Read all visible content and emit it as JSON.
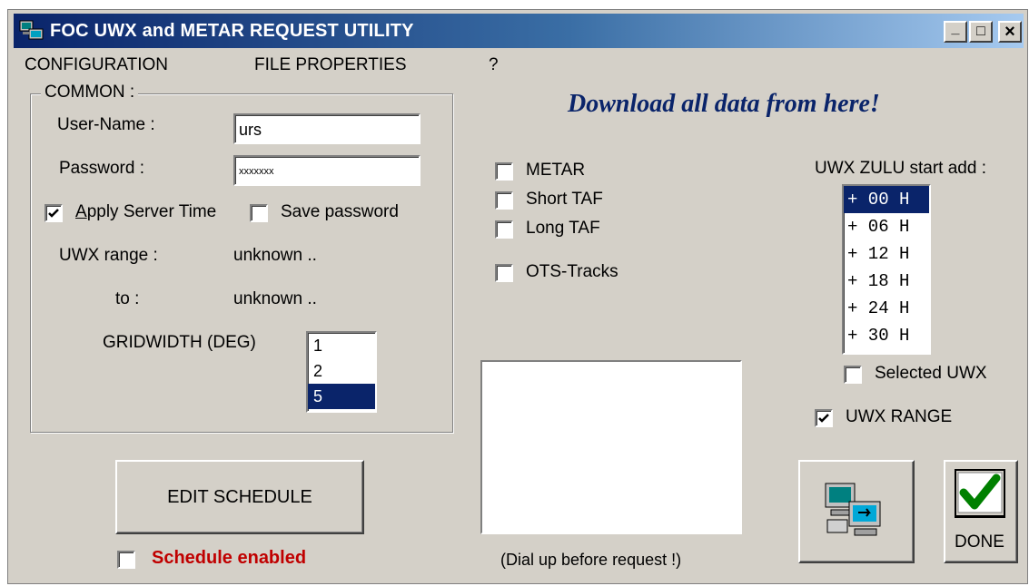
{
  "window": {
    "title": "FOC UWX and METAR REQUEST UTILITY",
    "minimize_glyph": "_",
    "maximize_glyph": "□",
    "close_glyph": "×"
  },
  "menu": {
    "items": [
      "CONFIGURATION",
      "FILE PROPERTIES",
      "?"
    ]
  },
  "common": {
    "legend": "COMMON :",
    "username_label": "User-Name :",
    "username_value": "urs",
    "password_label": "Password :",
    "password_value": "xxxxxxx",
    "apply_server_time_label": "Apply Server Time",
    "apply_server_time_checked": true,
    "save_password_label": "Save password",
    "save_password_checked": false,
    "uwx_range_label": "UWX range :",
    "uwx_range_value": "unknown ..",
    "to_label": "to :",
    "to_value": "unknown ..",
    "gridwidth_label": "GRIDWIDTH (DEG)",
    "gridwidth_options": [
      "1",
      "2",
      "5"
    ],
    "gridwidth_selected": "5"
  },
  "heading": "Download all  data from here!",
  "data_types": {
    "metar_label": "METAR",
    "short_taf_label": "Short TAF",
    "long_taf_label": "Long TAF",
    "ots_tracks_label": "OTS-Tracks"
  },
  "zulu": {
    "label": "UWX ZULU start add :",
    "options": [
      "+ 00 H",
      "+ 06 H",
      "+ 12 H",
      "+ 18 H",
      "+ 24 H",
      "+ 30 H"
    ],
    "selected": "+ 00 H",
    "selected_uwx_label": "Selected UWX",
    "selected_uwx_checked": false,
    "uwx_range_label": "UWX RANGE",
    "uwx_range_checked": true
  },
  "schedule": {
    "edit_button_label": "EDIT SCHEDULE",
    "enabled_label": "Schedule enabled",
    "enabled_checked": false
  },
  "dial_note": "(Dial up before request !)",
  "done_button_label": "DONE",
  "colors": {
    "title_gradient_start": "#0a246a",
    "selection": "#0a246a",
    "heading": "#0a246a",
    "schedule_text": "#c00000",
    "done_check": "#008000"
  }
}
